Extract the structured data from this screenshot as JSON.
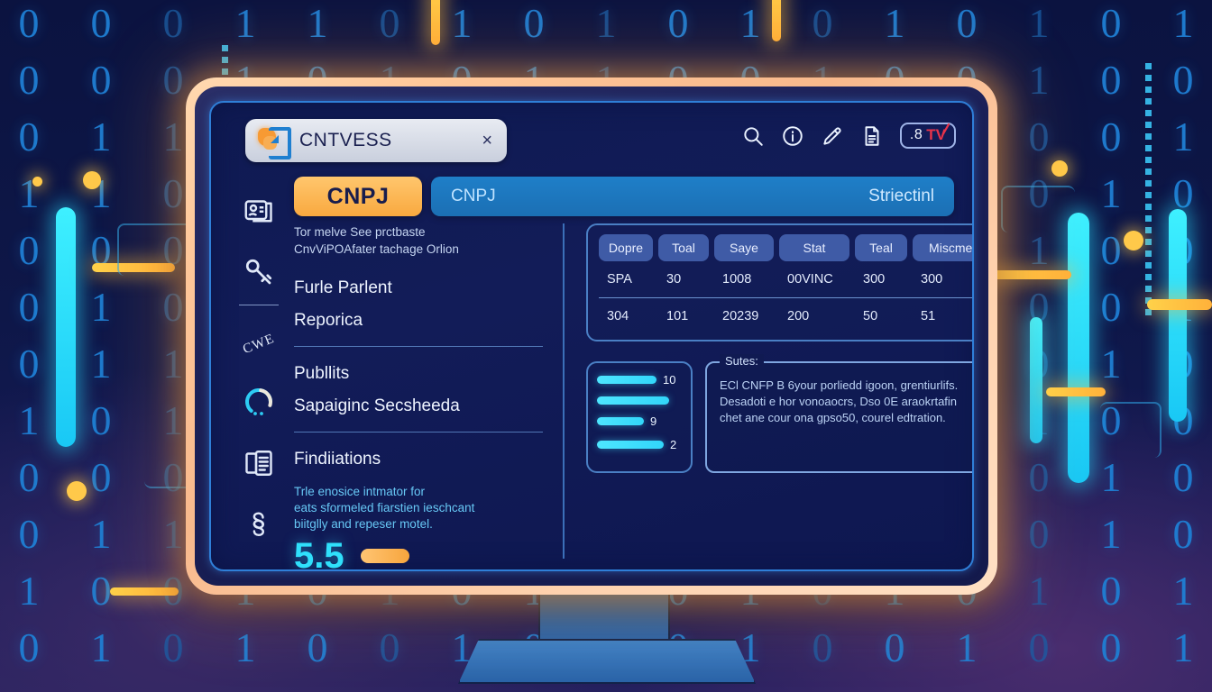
{
  "window": {
    "tab_title": "CNTVESS",
    "close_label": "×",
    "logo_icon": "app-logo-icon"
  },
  "toolbar": {
    "icons": [
      {
        "name": "search-icon",
        "label": "search"
      },
      {
        "name": "info-circle-icon",
        "label": "info"
      },
      {
        "name": "pencil-edit-icon",
        "label": "edit"
      },
      {
        "name": "document-icon",
        "label": "document"
      }
    ],
    "badge": {
      "number": ".8",
      "brand": "TV",
      "check_icon": "red-check-icon"
    }
  },
  "tabs": {
    "primary_label": "CNPJ",
    "secondary_left": "CNPJ",
    "secondary_right": "Striectinl"
  },
  "sidebar": {
    "items": [
      {
        "name": "sidebar-item-id-card",
        "icon": "id-card-icon"
      },
      {
        "name": "sidebar-item-key",
        "icon": "key-icon"
      },
      {
        "name": "sidebar-item-cwe",
        "icon": "cwe-text-icon",
        "label": "CWE"
      },
      {
        "name": "sidebar-item-progress",
        "icon": "progress-ring-icon"
      },
      {
        "name": "sidebar-item-documents",
        "icon": "documents-icon"
      },
      {
        "name": "sidebar-item-section",
        "icon": "section-sign-icon"
      }
    ]
  },
  "left_panel": {
    "lead_line1": "Tor melve See prctbaste",
    "lead_line2": "CnvViPOAfater tachage Orlion",
    "item1": "Furle Parlent",
    "item2": "Reporica",
    "item3": "Publlits",
    "item4": "Sapaiginc Secsheeda",
    "section_title": "Findiiations",
    "body_line1": "Trle enosice intmator for",
    "body_line2": "eats sformeled fiarstien ieschcant",
    "body_line3": "biitglly and repeser motel.",
    "metric_value": "5.5"
  },
  "table": {
    "headers": [
      "Dopre",
      "Toal",
      "Saye",
      "Stat",
      "Teal",
      "Miscment"
    ],
    "rows": [
      [
        "SPA",
        "30",
        "1008",
        "00VINC",
        "300",
        "300"
      ],
      [
        "304",
        "101",
        "20239",
        "200",
        "50",
        "51"
      ]
    ]
  },
  "bars": {
    "items": [
      {
        "value": "10",
        "width": 66
      },
      {
        "value": "",
        "width": 80
      },
      {
        "value": "9",
        "width": 52
      },
      {
        "value": "2",
        "width": 74
      }
    ]
  },
  "note": {
    "title": "Sutes:",
    "line1": "ECl CNFP B 6your porliedd igoon, grentiurlifs.",
    "line2": "Desadoti e hor vonoaocrs, Dso 0E araokrtafin",
    "line3": "chet ane cour ona gpso50, courel edtration."
  },
  "background": {
    "binary_columns": [
      "0 0 0 1 0 0 0 1 0 0 1 0",
      "0 0 1 1 0 1 1 0 0 1 0 1",
      "0 0 1 0 0 0 1 1 0 1 0 0",
      "1 1 0 1 1 1 0 1 1 0 1 1",
      "1 0 0 0 0 0 1 0 1 0 0 0",
      "0 1 0 1 0 1 0 0 1 1 1 0",
      "1 0 1 0 1 0 1 1 0 0 0 1",
      "0 1 0 0 1 0 0 1 0 1 1 0",
      "1 1 0 1 0 1 1 0 1 0 0 1",
      "0 0 1 0 0 0 0 1 0 1 0 0",
      "1 0 0 1 1 0 1 0 0 0 1 1",
      "0 1 1 0 0 1 0 1 1 0 0 0",
      "1 0 0 0 1 0 0 0 0 1 1 0",
      "0 0 1 1 0 1 1 0 1 0 0 1",
      "1 1 0 0 1 0 0 1 0 0 1 0",
      "0 0 0 1 0 0 1 0 1 1 0 0",
      "1 0 1 0 0 1 0 0 0 0 1 1"
    ],
    "accent_cyan": "#3ef0ff",
    "accent_yellow": "#ffc94a",
    "digit_color": "#1f7fd4"
  }
}
